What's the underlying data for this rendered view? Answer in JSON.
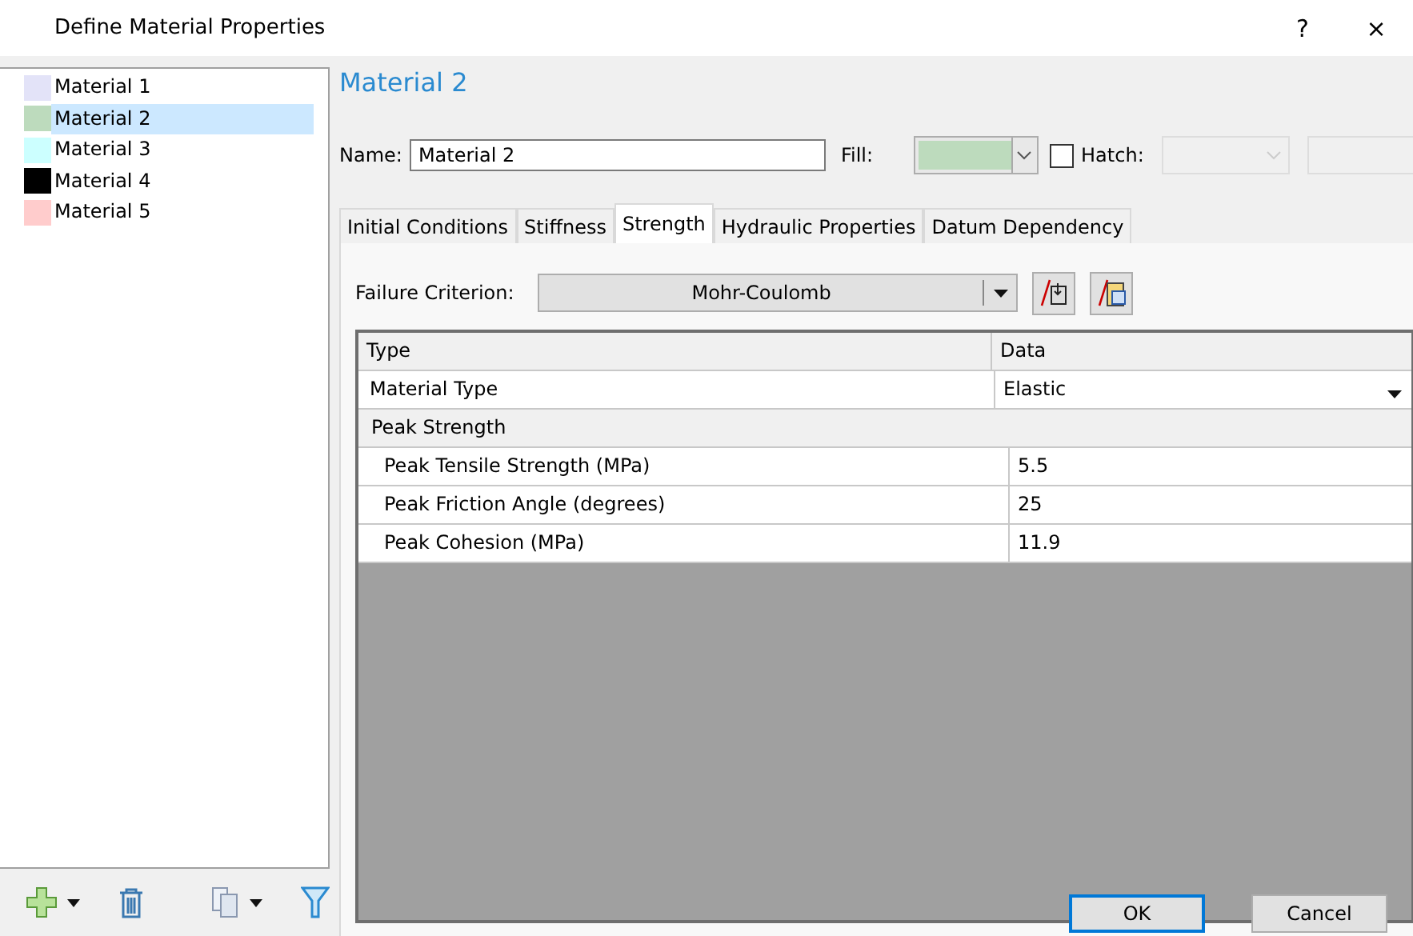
{
  "window": {
    "title": "Define Material Properties",
    "help": "?",
    "close": "×"
  },
  "materials": [
    {
      "label": "Material 1",
      "color": "#e3e3f8",
      "selected": false
    },
    {
      "label": "Material 2",
      "color": "#bddbbd",
      "selected": true
    },
    {
      "label": "Material 3",
      "color": "#ccffff",
      "selected": false
    },
    {
      "label": "Material 4",
      "color": "#000000",
      "selected": false
    },
    {
      "label": "Material 5",
      "color": "#ffcccc",
      "selected": false
    }
  ],
  "heading": "Material 2",
  "name": {
    "label": "Name:",
    "value": "Material 2"
  },
  "fill": {
    "label": "Fill:",
    "color": "#bddbbd"
  },
  "hatch": {
    "label": "Hatch:",
    "checked": false
  },
  "tabs": [
    {
      "label": "Initial Conditions",
      "selected": false
    },
    {
      "label": "Stiffness",
      "selected": false
    },
    {
      "label": "Strength",
      "selected": true
    },
    {
      "label": "Hydraulic Properties",
      "selected": false
    },
    {
      "label": "Datum Dependency",
      "selected": false
    }
  ],
  "failure_criterion": {
    "label": "Failure Criterion:",
    "value": "Mohr-Coulomb"
  },
  "table": {
    "columns": [
      "Type",
      "Data"
    ],
    "rows": [
      {
        "kind": "dropdown",
        "type": "Material Type",
        "data": "Elastic"
      },
      {
        "kind": "group",
        "type": "Peak Strength"
      },
      {
        "kind": "child",
        "type": "Peak Tensile Strength (MPa)",
        "data": "5.5"
      },
      {
        "kind": "child",
        "type": "Peak Friction Angle (degrees)",
        "data": "25"
      },
      {
        "kind": "child",
        "type": "Peak Cohesion (MPa)",
        "data": "11.9"
      }
    ]
  },
  "buttons": [
    "OK",
    "Cancel"
  ]
}
